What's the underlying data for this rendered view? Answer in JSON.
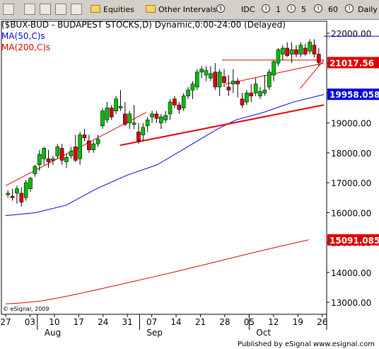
{
  "toolbar": {
    "equities_label": "Equities",
    "intervals_label": "Other Intervals",
    "idc_label": "IDC",
    "int1_label": "1",
    "int5_label": "5",
    "int60_label": "60",
    "daily_label": "Daily"
  },
  "chart_title": "($BUX-BUD - BUDAPEST STOCKS,D) Dynamic,0:00-24:00 (Delayed)",
  "ma50_label": "MA(50,C)s",
  "ma200_label": "MA(200,C)s",
  "copyright": "© eSignal, 2009",
  "footer": "Published by eSignal  www.esignal.com",
  "colors": {
    "up": "#00c000",
    "down": "#e00000",
    "ma50": "#0000e0",
    "ma200": "#e00000",
    "trend": "#e00000",
    "blue_line": "#0000ff"
  },
  "chart_data": {
    "type": "candlestick",
    "ylim": [
      12600,
      22400
    ],
    "y_ticks": [
      13000,
      14000,
      15000,
      16000,
      17000,
      18000,
      19000,
      20000,
      21000,
      22000
    ],
    "x_tick_labels": [
      "27",
      "03",
      "10",
      "17",
      "24",
      "31",
      "07",
      "14",
      "21",
      "28",
      "05",
      "12",
      "19",
      "26"
    ],
    "month_labels": [
      "Aug",
      "Sep",
      "Oct"
    ],
    "price_tags": [
      {
        "value": "21017.56",
        "color": "#e00000"
      },
      {
        "value": "19958.0584",
        "color": "#0000e0"
      },
      {
        "value": "15091.085",
        "color": "#e00000"
      }
    ],
    "candles": [
      [
        16600,
        16750,
        16500,
        16650
      ],
      [
        16550,
        16800,
        16400,
        16500
      ],
      [
        16650,
        16900,
        16300,
        16800
      ],
      [
        16650,
        16850,
        16200,
        16350
      ],
      [
        16500,
        17100,
        16400,
        17000
      ],
      [
        16800,
        17200,
        16700,
        17150
      ],
      [
        17300,
        17600,
        17200,
        17550
      ],
      [
        17600,
        18100,
        17400,
        17950
      ],
      [
        17800,
        18200,
        17600,
        18150
      ],
      [
        17800,
        18100,
        17500,
        17700
      ],
      [
        17750,
        17900,
        17600,
        17800
      ],
      [
        17900,
        18300,
        17800,
        18200
      ],
      [
        18150,
        18300,
        17600,
        17750
      ],
      [
        17700,
        17950,
        17500,
        17850
      ],
      [
        17900,
        18200,
        17800,
        18050
      ],
      [
        18200,
        18600,
        17700,
        17750
      ],
      [
        17800,
        18700,
        17600,
        18600
      ],
      [
        18600,
        18800,
        18400,
        18500
      ],
      [
        18400,
        18600,
        18000,
        18100
      ],
      [
        18100,
        18400,
        18000,
        18300
      ],
      [
        18300,
        18600,
        18200,
        18450
      ],
      [
        18900,
        19500,
        18800,
        19400
      ],
      [
        19100,
        19700,
        19000,
        19500
      ],
      [
        19500,
        19600,
        19100,
        19200
      ],
      [
        19400,
        19900,
        19300,
        19800
      ],
      [
        19500,
        20100,
        19400,
        19550
      ],
      [
        19300,
        19700,
        18900,
        18950
      ],
      [
        19000,
        19400,
        18800,
        19300
      ],
      [
        18950,
        19600,
        18800,
        19000
      ],
      [
        18700,
        19000,
        18300,
        18400
      ],
      [
        18600,
        19000,
        18400,
        18850
      ],
      [
        18900,
        19200,
        18700,
        19100
      ],
      [
        19200,
        19400,
        19000,
        19300
      ],
      [
        19300,
        19400,
        19000,
        19150
      ],
      [
        19000,
        19300,
        18800,
        19200
      ],
      [
        19100,
        19400,
        19000,
        19250
      ],
      [
        19300,
        19800,
        19100,
        19700
      ],
      [
        19800,
        19900,
        19500,
        19600
      ],
      [
        19600,
        19700,
        19300,
        19450
      ],
      [
        19500,
        20000,
        19400,
        19900
      ],
      [
        19900,
        20200,
        19800,
        20100
      ],
      [
        20100,
        20400,
        19800,
        20300
      ],
      [
        20200,
        20800,
        20100,
        20700
      ],
      [
        20700,
        20900,
        20500,
        20800
      ],
      [
        20600,
        20900,
        20400,
        20750
      ],
      [
        20500,
        20900,
        20400,
        20650
      ],
      [
        20700,
        21000,
        20100,
        20200
      ],
      [
        20200,
        20800,
        19900,
        20700
      ],
      [
        20550,
        20800,
        20200,
        20350
      ],
      [
        20200,
        20600,
        19900,
        20100
      ],
      [
        20300,
        20800,
        20000,
        20400
      ],
      [
        20400,
        20500,
        19850,
        20300
      ],
      [
        19800,
        20000,
        19500,
        19600
      ],
      [
        19700,
        20100,
        19600,
        20000
      ],
      [
        20000,
        20300,
        19700,
        19900
      ],
      [
        20000,
        20500,
        19900,
        20300
      ],
      [
        19900,
        20200,
        19800,
        20050
      ],
      [
        20000,
        20600,
        19900,
        20100
      ],
      [
        20200,
        20800,
        20100,
        20700
      ],
      [
        20600,
        21100,
        20400,
        21050
      ],
      [
        21000,
        21500,
        20900,
        21450
      ],
      [
        21300,
        21600,
        21100,
        21500
      ],
      [
        21500,
        21700,
        21200,
        21250
      ],
      [
        21300,
        21700,
        21000,
        21450
      ],
      [
        21450,
        21600,
        21200,
        21300
      ],
      [
        21300,
        21700,
        21200,
        21600
      ],
      [
        21500,
        21650,
        21250,
        21300
      ],
      [
        21400,
        21800,
        21300,
        21700
      ],
      [
        21600,
        21800,
        21200,
        21300
      ],
      [
        21300,
        21500,
        20900,
        21017
      ]
    ],
    "ma50": [
      [
        0,
        15900
      ],
      [
        10,
        16000
      ],
      [
        20,
        16250
      ],
      [
        30,
        16800
      ],
      [
        40,
        17250
      ],
      [
        50,
        17600
      ],
      [
        60,
        18200
      ],
      [
        70,
        18800
      ],
      [
        76,
        19100
      ],
      [
        85,
        19350
      ],
      [
        95,
        19700
      ],
      [
        105,
        19950
      ]
    ],
    "ma200": [
      [
        0,
        12950
      ],
      [
        5,
        12980
      ],
      [
        12,
        13050
      ],
      [
        20,
        13200
      ],
      [
        30,
        13420
      ],
      [
        40,
        13650
      ],
      [
        50,
        13880
      ],
      [
        60,
        14120
      ],
      [
        70,
        14370
      ],
      [
        80,
        14620
      ],
      [
        90,
        14860
      ],
      [
        100,
        15091
      ]
    ],
    "trendlines": [
      {
        "from": [
          0,
          16900
        ],
        "to": [
          32,
          19350
        ]
      },
      {
        "from": [
          26,
          18250
        ],
        "to": [
          98,
          19600
        ]
      },
      {
        "from": [
          50,
          20300
        ],
        "to": [
          98,
          21000
        ]
      },
      {
        "from": [
          67,
          20150
        ],
        "to": [
          98,
          21100
        ]
      }
    ],
    "resistance": [
      {
        "from": [
          51,
          21100
        ],
        "to": [
          98,
          21100
        ],
        "color": "#e00000"
      },
      {
        "from": [
          89,
          21900
        ],
        "to": [
          98,
          21900
        ],
        "color": "#0000ff"
      }
    ]
  }
}
